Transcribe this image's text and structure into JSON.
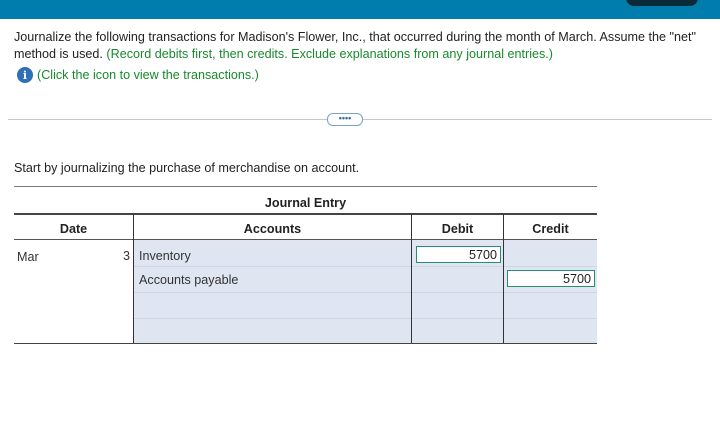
{
  "question": {
    "text_main": "Journalize the following transactions for Madison's Flower, Inc., that occurred during the month of March. Assume the \"net\" method is used. ",
    "text_green": "(Record debits first, then credits. Exclude explanations from any journal entries.)",
    "info_link": "(Click the icon to view the transactions.)",
    "info_icon": "info-icon"
  },
  "more_button": "••••",
  "instruction": "Start by journalizing the purchase of merchandise on account.",
  "journal": {
    "title": "Journal Entry",
    "headers": {
      "date": "Date",
      "accounts": "Accounts",
      "debit": "Debit",
      "credit": "Credit"
    },
    "month": "Mar",
    "day": "3",
    "rows": [
      {
        "account": "Inventory",
        "debit": "5700",
        "credit": ""
      },
      {
        "account": "Accounts payable",
        "debit": "",
        "credit": "5700"
      }
    ]
  },
  "colors": {
    "topbar": "#007dad",
    "instruction_green": "#178a2c",
    "table_shade": "#dfe6f1"
  }
}
